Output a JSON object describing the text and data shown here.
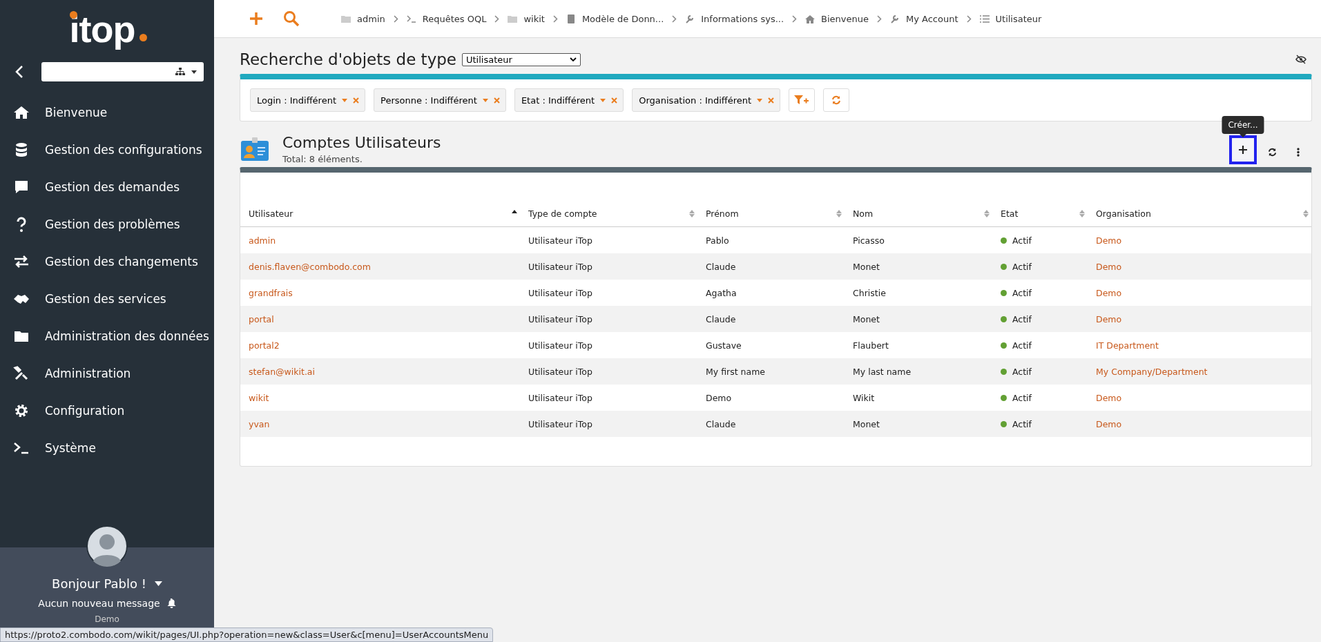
{
  "sidebar": {
    "logo": "itop",
    "items": [
      {
        "label": "Bienvenue"
      },
      {
        "label": "Gestion des configurations"
      },
      {
        "label": "Gestion des demandes"
      },
      {
        "label": "Gestion des problèmes"
      },
      {
        "label": "Gestion des changements"
      },
      {
        "label": "Gestion des services"
      },
      {
        "label": "Administration des données"
      },
      {
        "label": "Administration"
      },
      {
        "label": "Configuration"
      },
      {
        "label": "Système"
      }
    ],
    "user": {
      "greeting": "Bonjour Pablo !",
      "messages": "Aucun nouveau message",
      "organization": "Demo"
    }
  },
  "breadcrumbs": [
    {
      "label": "admin"
    },
    {
      "label": "Requêtes OQL"
    },
    {
      "label": "wikit"
    },
    {
      "label": "Modèle de Donn..."
    },
    {
      "label": "Informations sys..."
    },
    {
      "label": "Bienvenue"
    },
    {
      "label": "My Account"
    },
    {
      "label": "Utilisateur"
    }
  ],
  "search": {
    "title": "Recherche d'objets de type",
    "class_select": "Utilisateur",
    "criteria": [
      {
        "label": "Login : Indifférent"
      },
      {
        "label": "Personne : Indifférent"
      },
      {
        "label": "Etat : Indifférent"
      },
      {
        "label": "Organisation : Indifférent"
      }
    ]
  },
  "list": {
    "title": "Comptes Utilisateurs",
    "total": "Total: 8 éléments.",
    "create_tooltip": "Créer...",
    "create_focused": true,
    "columns": [
      {
        "label": "Utilisateur",
        "sorted": true
      },
      {
        "label": "Type de compte",
        "sorted": false
      },
      {
        "label": "Prénom",
        "sorted": false
      },
      {
        "label": "Nom",
        "sorted": false
      },
      {
        "label": "Etat",
        "sorted": false
      },
      {
        "label": "Organisation",
        "sorted": false
      }
    ],
    "rows": [
      {
        "login": "admin",
        "type": "Utilisateur iTop",
        "first_name": "Pablo",
        "last_name": "Picasso",
        "status": "Actif",
        "color": "#62a033",
        "organization": "Demo"
      },
      {
        "login": "denis.flaven@combodo.com",
        "type": "Utilisateur iTop",
        "first_name": "Claude",
        "last_name": "Monet",
        "status": "Actif",
        "color": "#62a033",
        "organization": "Demo"
      },
      {
        "login": "grandfrais",
        "type": "Utilisateur iTop",
        "first_name": "Agatha",
        "last_name": "Christie",
        "status": "Actif",
        "color": "#62a033",
        "organization": "Demo"
      },
      {
        "login": "portal",
        "type": "Utilisateur iTop",
        "first_name": "Claude",
        "last_name": "Monet",
        "status": "Actif",
        "color": "#62a033",
        "organization": "Demo"
      },
      {
        "login": "portal2",
        "type": "Utilisateur iTop",
        "first_name": "Gustave",
        "last_name": "Flaubert",
        "status": "Actif",
        "color": "#62a033",
        "organization": "IT Department"
      },
      {
        "login": "stefan@wikit.ai",
        "type": "Utilisateur iTop",
        "first_name": "My first name",
        "last_name": "My last name",
        "status": "Actif",
        "color": "#62a033",
        "organization": "My Company/Department"
      },
      {
        "login": "wikit",
        "type": "Utilisateur iTop",
        "first_name": "Demo",
        "last_name": "Wikit",
        "status": "Actif",
        "color": "#62a033",
        "organization": "Demo"
      },
      {
        "login": "yvan",
        "type": "Utilisateur iTop",
        "first_name": "Claude",
        "last_name": "Monet",
        "status": "Actif",
        "color": "#62a033",
        "organization": "Demo"
      }
    ]
  },
  "status_bar": {
    "url": "https://proto2.combodo.com/wikit/pages/UI.php?operation=new&class=User&c[menu]=UserAccountsMenu"
  }
}
